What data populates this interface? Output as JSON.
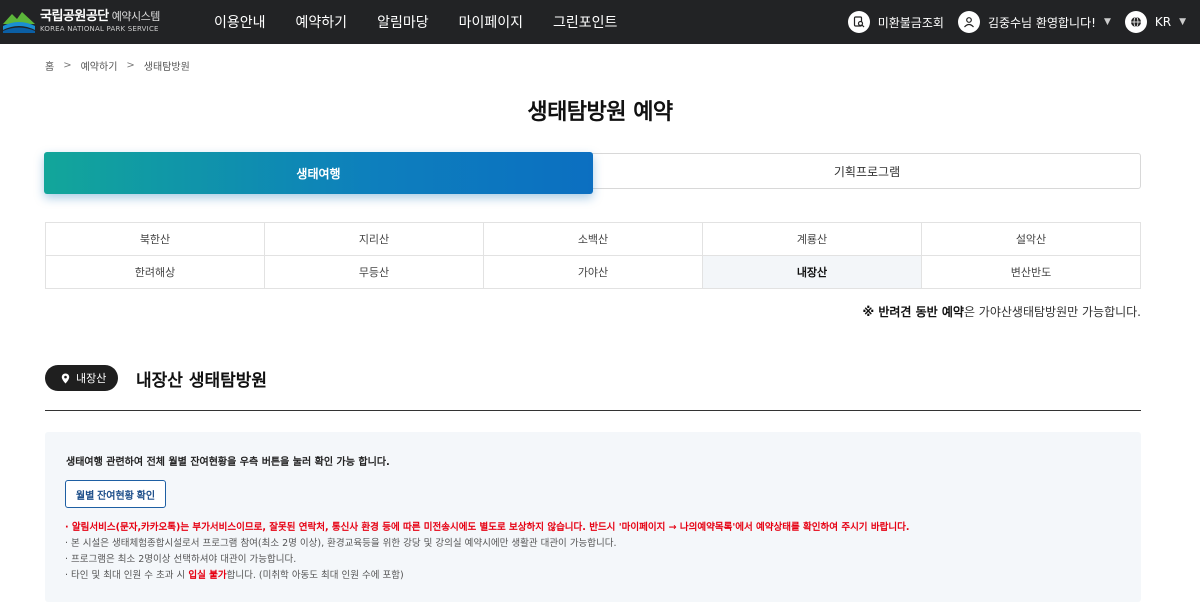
{
  "header": {
    "logo_ko": "국립공원공단",
    "logo_sub": "예약시스템",
    "logo_en": "KOREA NATIONAL PARK SERVICE",
    "nav": [
      "이용안내",
      "예약하기",
      "알림마당",
      "마이페이지",
      "그린포인트"
    ],
    "refund_check": "미환불금조회",
    "user_greeting": "김중수님 환영합니다!",
    "language": "KR"
  },
  "breadcrumb": {
    "home": "홈",
    "level1": "예약하기",
    "level2": "생태탐방원"
  },
  "page_title": "생태탐방원 예약",
  "tabs": [
    {
      "label": "생태여행",
      "active": true
    },
    {
      "label": "기획프로그램",
      "active": false
    }
  ],
  "regions": [
    {
      "label": "북한산",
      "selected": false
    },
    {
      "label": "지리산",
      "selected": false
    },
    {
      "label": "소백산",
      "selected": false
    },
    {
      "label": "계룡산",
      "selected": false
    },
    {
      "label": "설악산",
      "selected": false
    },
    {
      "label": "한려해상",
      "selected": false
    },
    {
      "label": "무등산",
      "selected": false
    },
    {
      "label": "가야산",
      "selected": false
    },
    {
      "label": "내장산",
      "selected": true
    },
    {
      "label": "변산반도",
      "selected": false
    }
  ],
  "pet_notice": {
    "prefix": "※ 반려견 동반 예약",
    "suffix": "은 가야산생태탐방원만 가능합니다."
  },
  "section": {
    "badge": "내장산",
    "title": "내장산 생태탐방원"
  },
  "info": {
    "lead": "생태여행 관련하여 전체 월별 잔여현황을 우측 버튼을 눌러 확인 가능 합니다.",
    "month_button": "월별 잔여현황 확인",
    "notes": [
      "· 알림서비스(문자,카카오톡)는 부가서비스이므로, 잘못된 연락처, 통신사 환경 등에 따른 미전송시에도 별도로 보상하지 않습니다. 반드시 '마이페이지 → 나의예약목록'에서 예약상태를 확인하여 주시기 바랍니다.",
      "· 본 시설은 생태체험종합시설로서 프로그램 참여(최소 2명 이상), 환경교육등을 위한 강당 및 강의실 예약시에만 생활관 대관이 가능합니다.",
      "· 프로그램은 최소 2명이상 선택하셔야 대관이 가능합니다."
    ],
    "note4_prefix": "· 타인 및 최대 인원 수 초과 시 ",
    "note4_red": "입실 불가",
    "note4_suffix": "합니다. (미취학 아동도 최대 인원 수에 포함)"
  },
  "colors": {
    "header_bg": "#222325",
    "tab_gradient_start": "#12a69a",
    "tab_gradient_end": "#0c6fc1",
    "alert_red": "#e60012"
  }
}
